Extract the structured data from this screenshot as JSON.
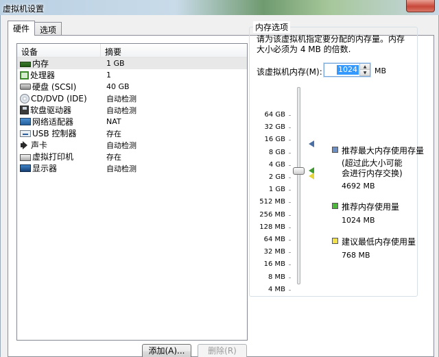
{
  "window": {
    "title": "虚拟机设置"
  },
  "tabs": [
    {
      "label": "硬件"
    },
    {
      "label": "选项"
    }
  ],
  "device_list": {
    "col_device": "设备",
    "col_summary": "摘要",
    "rows": [
      {
        "name": "内存",
        "summary": "1 GB",
        "icon": "memory-icon"
      },
      {
        "name": "处理器",
        "summary": "1",
        "icon": "processor-icon"
      },
      {
        "name": "硬盘 (SCSI)",
        "summary": "40 GB",
        "icon": "hard-disk-icon"
      },
      {
        "name": "CD/DVD (IDE)",
        "summary": "自动检测",
        "icon": "cd-dvd-icon"
      },
      {
        "name": "软盘驱动器",
        "summary": "自动检测",
        "icon": "floppy-icon"
      },
      {
        "name": "网络适配器",
        "summary": "NAT",
        "icon": "network-adapter-icon"
      },
      {
        "name": "USB 控制器",
        "summary": "存在",
        "icon": "usb-icon"
      },
      {
        "name": "声卡",
        "summary": "自动检测",
        "icon": "speaker-icon"
      },
      {
        "name": "虚拟打印机",
        "summary": "存在",
        "icon": "printer-icon"
      },
      {
        "name": "显示器",
        "summary": "自动检测",
        "icon": "display-icon"
      }
    ]
  },
  "buttons": {
    "add": "添加(A)...",
    "remove": "删除(R)"
  },
  "memory": {
    "group_title": "内存选项",
    "description_line1": "请为该虚拟机指定要分配的内存量。内存",
    "description_line2": "大小必须为 4 MB 的倍数.",
    "field_label": "该虚拟机内存(M):",
    "value": "1024",
    "unit": "MB",
    "scale": [
      "64 GB",
      "32 GB",
      "16 GB",
      "8 GB",
      "4 GB",
      "2 GB",
      "1 GB",
      "512 MB",
      "256 MB",
      "128 MB",
      "64 MB",
      "32 MB",
      "16 MB",
      "8 MB",
      "4 MB"
    ],
    "legend": {
      "max_title": "推荐最大内存使用存量",
      "max_note1": "(超过此大小可能",
      "max_note2": "会进行内存交换)",
      "max_value": "4692 MB",
      "rec_title": "推荐内存使用量",
      "rec_value": "1024 MB",
      "min_title": "建议最低内存使用量",
      "min_value": "768 MB"
    },
    "colors": {
      "max": "#6b8fc4",
      "recommended": "#4bb83a",
      "minimum": "#f2e24a"
    }
  }
}
